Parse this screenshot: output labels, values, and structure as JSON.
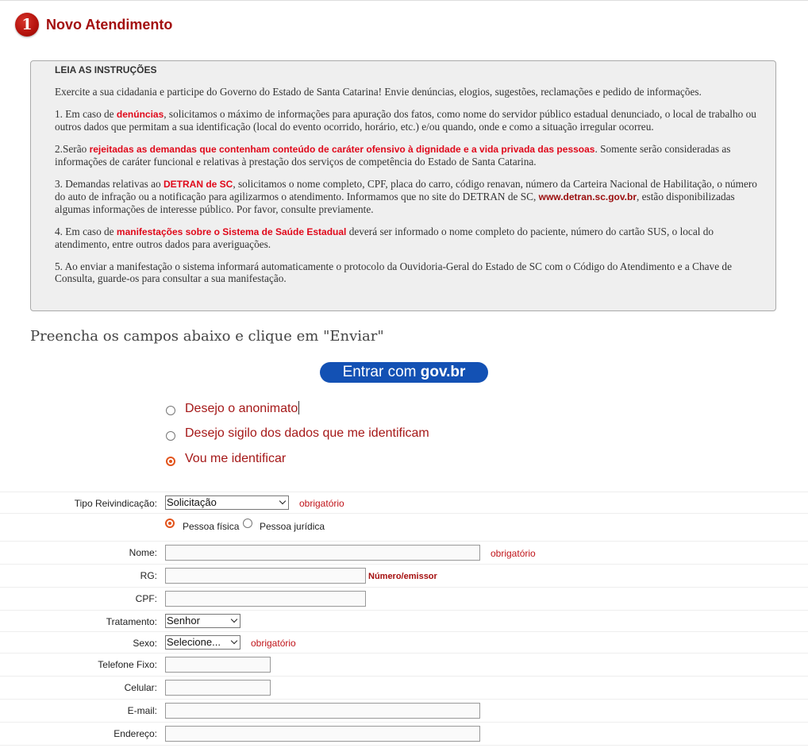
{
  "step": {
    "number": "1",
    "title": "Novo Atendimento"
  },
  "instructions": {
    "title": "LEIA AS INSTRUÇÕES",
    "intro": "Exercite a sua cidadania e participe do Governo do Estado de Santa Catarina! Envie denúncias, elogios, sugestões, reclamações e pedido de informações.",
    "item1": {
      "before": "1. Em caso de ",
      "highlight": "denúncias",
      "after": ", solicitamos o máximo de informações para apuração dos fatos, como nome do servidor público estadual denunciado, o local de trabalho ou outros dados que permitam a sua identificação (local do evento ocorrido, horário, etc.) e/ou quando, onde e como a situação irregular ocorreu."
    },
    "item2": {
      "before": "2.Serão ",
      "highlight": "rejeitadas as demandas que contenham conteúdo de caráter ofensivo à dignidade e a vida privada das pessoas",
      "after": ". Somente serão consideradas as informações de caráter funcional e relativas à prestação dos serviços de competência do Estado de Santa Catarina."
    },
    "item3": {
      "before": "3. Demandas relativas ao ",
      "highlight": "DETRAN de SC",
      "middle": ", solicitamos o nome completo, CPF, placa do carro, código renavan, número da Carteira Nacional de Habilitação, o número do auto de infração ou a notificação para agilizarmos o atendimento. Informamos que no site do DETRAN de SC, ",
      "link": "www.detran.sc.gov.br",
      "after": ", estão disponibilizadas algumas informações de interesse público. Por favor, consulte previamente."
    },
    "item4": {
      "before": "4. Em caso de ",
      "highlight": "manifestações sobre o Sistema de Saúde Estadual",
      "after": " deverá ser informado o nome completo do paciente, número do cartão SUS, o local do atendimento, entre outros dados para averiguações."
    },
    "item5": "5. Ao enviar a manifestação o sistema informará automaticamente o protocolo da Ouvidoria-Geral do Estado de SC com o Código do Atendimento e a Chave de Consulta, guarde-os para consultar a sua manifestação."
  },
  "fill_heading": "Preencha os campos abaixo e clique em \"Enviar\"",
  "govbr": {
    "prefix": "Entrar com ",
    "brand": "gov.br",
    "color": "#1351b4"
  },
  "identity_options": [
    {
      "label": "Desejo o anonimato",
      "selected": false
    },
    {
      "label": "Desejo sigilo dos dados que me identificam",
      "selected": false
    },
    {
      "label": "Vou me identificar",
      "selected": true
    }
  ],
  "form": {
    "tipo": {
      "label": "Tipo Reivindicação:",
      "value": "Solicitação",
      "note": "obrigatório"
    },
    "pessoa": {
      "fisica": "Pessoa física",
      "juridica": "Pessoa jurídica",
      "selected": "fisica"
    },
    "nome": {
      "label": "Nome:",
      "value": "",
      "note": "obrigatório"
    },
    "rg": {
      "label": "RG:",
      "value": "",
      "note": "Número/emissor"
    },
    "cpf": {
      "label": "CPF:",
      "value": ""
    },
    "tratamento": {
      "label": "Tratamento:",
      "value": "Senhor"
    },
    "sexo": {
      "label": "Sexo:",
      "value": "Selecione...",
      "note": "obrigatório"
    },
    "telefone": {
      "label": "Telefone Fixo:",
      "value": ""
    },
    "celular": {
      "label": "Celular:",
      "value": ""
    },
    "email": {
      "label": "E-mail:",
      "value": ""
    },
    "endereco": {
      "label": "Endereço:",
      "value": ""
    }
  },
  "colors": {
    "accent_red": "#a30f0f",
    "highlight_red": "#e0081a",
    "radio_orange": "#e2541c"
  }
}
